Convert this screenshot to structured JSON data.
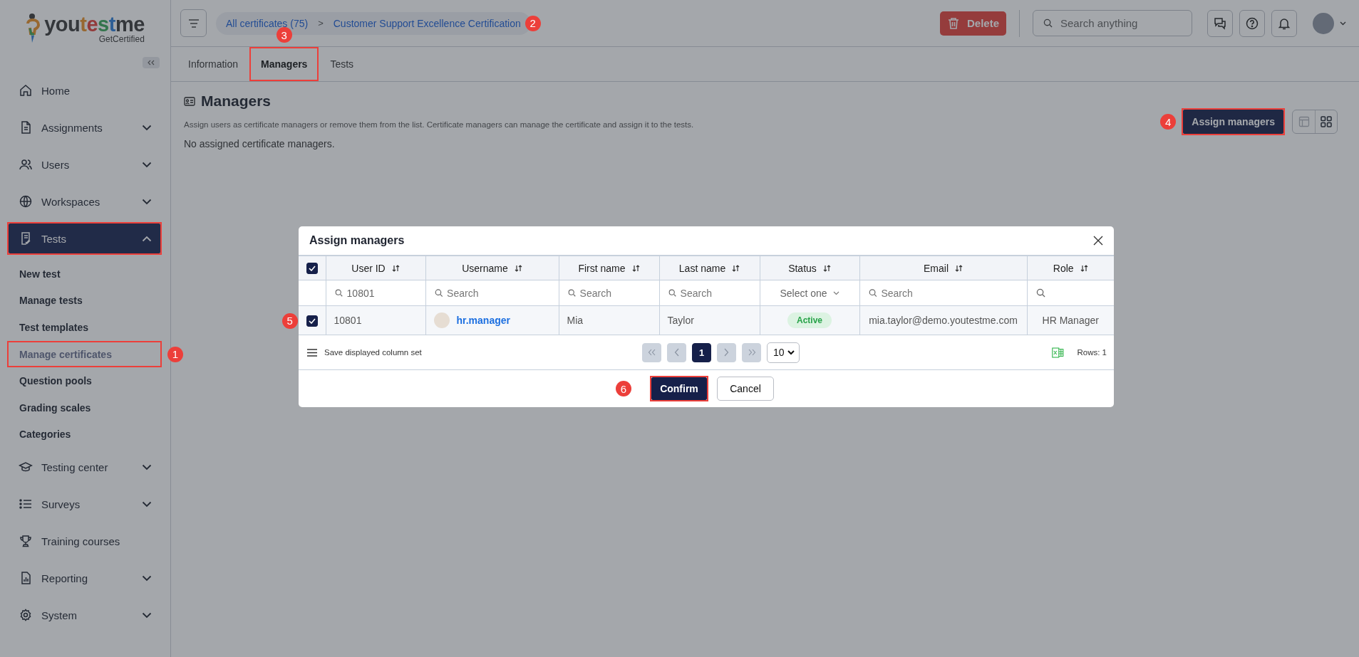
{
  "logo": {
    "wordmark": "youtestme",
    "tagline": "GetCertified"
  },
  "sidebar": {
    "items": [
      {
        "label": "Home",
        "expandable": false,
        "selected": false,
        "highlighted": false
      },
      {
        "label": "Assignments",
        "expandable": true,
        "expanded": false,
        "selected": false,
        "highlighted": false
      },
      {
        "label": "Users",
        "expandable": true,
        "expanded": false,
        "selected": false,
        "highlighted": false
      },
      {
        "label": "Workspaces",
        "expandable": true,
        "expanded": false,
        "selected": false,
        "highlighted": false
      },
      {
        "label": "Tests",
        "expandable": true,
        "expanded": true,
        "selected": true,
        "highlighted": true,
        "children": [
          {
            "label": "New test",
            "selected": false,
            "highlighted": false
          },
          {
            "label": "Manage tests",
            "selected": false,
            "highlighted": false
          },
          {
            "label": "Test templates",
            "selected": false,
            "highlighted": false
          },
          {
            "label": "Manage certificates",
            "selected": true,
            "highlighted": true,
            "callout": "1"
          },
          {
            "label": "Question pools",
            "selected": false,
            "highlighted": false
          },
          {
            "label": "Grading scales",
            "selected": false,
            "highlighted": false
          },
          {
            "label": "Categories",
            "selected": false,
            "highlighted": false
          }
        ]
      },
      {
        "label": "Testing center",
        "expandable": true,
        "expanded": false,
        "selected": false,
        "highlighted": false
      },
      {
        "label": "Surveys",
        "expandable": true,
        "expanded": false,
        "selected": false,
        "highlighted": false
      },
      {
        "label": "Training courses",
        "expandable": false,
        "selected": false,
        "highlighted": false
      },
      {
        "label": "Reporting",
        "expandable": true,
        "expanded": false,
        "selected": false,
        "highlighted": false
      },
      {
        "label": "System",
        "expandable": true,
        "expanded": false,
        "selected": false,
        "highlighted": false
      }
    ]
  },
  "header": {
    "breadcrumb": [
      {
        "label": "All certificates (75)"
      },
      {
        "label": "Customer Support Excellence Certification",
        "callout": "2"
      }
    ],
    "breadcrumb_separator": ">",
    "delete_button": "Delete",
    "search": {
      "placeholder": "Search anything"
    }
  },
  "tabs": [
    {
      "label": "Information",
      "selected": false,
      "highlighted": false
    },
    {
      "label": "Managers",
      "selected": true,
      "highlighted": true,
      "callout": "3"
    },
    {
      "label": "Tests",
      "selected": false,
      "highlighted": false
    }
  ],
  "section": {
    "title": "Managers",
    "description": "Assign users as certificate managers or remove them from the list. Certificate managers can manage the certificate and assign it to the tests.",
    "empty_message": "No assigned certificate managers.",
    "assign_button": {
      "label": "Assign managers",
      "highlighted": true,
      "callout": "4"
    },
    "view_toggle": [
      {
        "selected": false
      },
      {
        "selected": true
      }
    ]
  },
  "modal": {
    "title": "Assign managers",
    "select_all_checked": true,
    "columns": [
      "User ID",
      "Username",
      "First name",
      "Last name",
      "Status",
      "Email",
      "Role"
    ],
    "filters": [
      {
        "kind": "search",
        "value": "10801"
      },
      {
        "kind": "search",
        "placeholder": "Search"
      },
      {
        "kind": "search",
        "placeholder": "Search"
      },
      {
        "kind": "search",
        "placeholder": "Search"
      },
      {
        "kind": "select",
        "placeholder": "Select one"
      },
      {
        "kind": "search",
        "placeholder": "Search"
      },
      {
        "kind": "search"
      }
    ],
    "rows": [
      {
        "checked": true,
        "callout": "5",
        "user_id": "10801",
        "username": "hr.manager",
        "first_name": "Mia",
        "last_name": "Taylor",
        "status": "Active",
        "email": "mia.taylor@demo.youtestme.com",
        "role": "HR Manager"
      }
    ],
    "save_columns": "Save displayed column set",
    "pagination": [
      {
        "kind": "first",
        "disabled": true
      },
      {
        "kind": "prev",
        "disabled": true
      },
      {
        "kind": "page",
        "label": "1",
        "selected": true
      },
      {
        "kind": "next",
        "disabled": true
      },
      {
        "kind": "last",
        "disabled": true
      }
    ],
    "page_size": "10",
    "rows_count": "Rows: 1",
    "confirm_button": {
      "label": "Confirm",
      "highlighted": true,
      "callout": "6"
    },
    "cancel_button": "Cancel"
  }
}
